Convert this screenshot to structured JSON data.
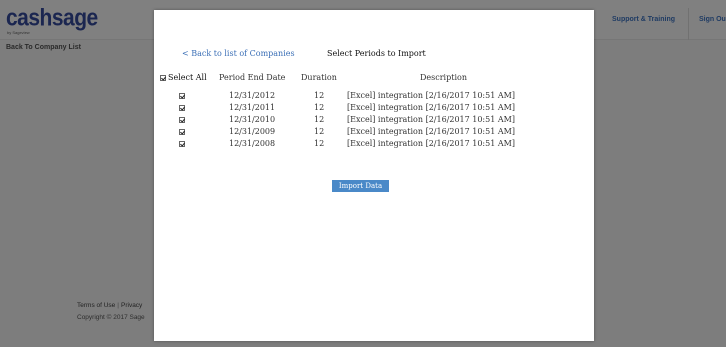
{
  "brand": {
    "logo_text": "cashsage",
    "logo_sub": "by Sageview"
  },
  "header": {
    "support_label": "Support & Training",
    "signout_label": "Sign Ou"
  },
  "sidebar": {
    "back_to_company_label": "Back To Company List"
  },
  "footer": {
    "terms_label": "Terms of Use",
    "privacy_label": "Privacy",
    "copyright": "Copyright © 2017 Sage"
  },
  "modal": {
    "back_link": "< Back to list of Companies",
    "title": "Select Periods to Import",
    "columns": {
      "select_all": "Select All",
      "period_end_date": "Period End Date",
      "duration": "Duration",
      "description": "Description"
    },
    "rows": [
      {
        "checked": true,
        "period_end_date": "12/31/2012",
        "duration": "12",
        "description": "[Excel] integration [2/16/2017 10:51 AM]"
      },
      {
        "checked": true,
        "period_end_date": "12/31/2011",
        "duration": "12",
        "description": "[Excel] integration [2/16/2017 10:51 AM]"
      },
      {
        "checked": true,
        "period_end_date": "12/31/2010",
        "duration": "12",
        "description": "[Excel] integration [2/16/2017 10:51 AM]"
      },
      {
        "checked": true,
        "period_end_date": "12/31/2009",
        "duration": "12",
        "description": "[Excel] integration [2/16/2017 10:51 AM]"
      },
      {
        "checked": true,
        "period_end_date": "12/31/2008",
        "duration": "12",
        "description": "[Excel] integration [2/16/2017 10:51 AM]"
      }
    ],
    "import_button": "Import Data"
  },
  "colors": {
    "overlay_gray": "#7f7f7f",
    "link_blue": "#3b6fb6",
    "button_blue": "#4a89c8",
    "brand_navy": "#1b2650"
  }
}
